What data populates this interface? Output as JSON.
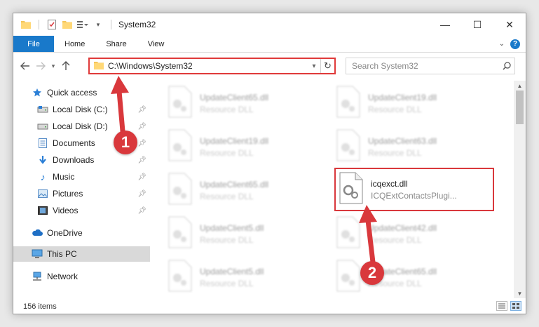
{
  "window": {
    "title": "System32",
    "controls": {
      "minimize": "—",
      "maximize": "☐",
      "close": "✕"
    }
  },
  "ribbon": {
    "tabs": [
      {
        "label": "File"
      },
      {
        "label": "Home"
      },
      {
        "label": "Share"
      },
      {
        "label": "View"
      }
    ],
    "help": "?"
  },
  "address": {
    "path": "C:\\Windows\\System32",
    "search_placeholder": "Search System32"
  },
  "sidebar": {
    "items": [
      {
        "label": "Quick access",
        "icon": "star-icon"
      },
      {
        "label": "Local Disk (C:)",
        "icon": "drive-icon",
        "pinned": true
      },
      {
        "label": "Local Disk (D:)",
        "icon": "drive-icon",
        "pinned": true
      },
      {
        "label": "Documents",
        "icon": "documents-icon",
        "pinned": true
      },
      {
        "label": "Downloads",
        "icon": "downloads-icon",
        "pinned": true
      },
      {
        "label": "Music",
        "icon": "music-icon",
        "pinned": true
      },
      {
        "label": "Pictures",
        "icon": "pictures-icon",
        "pinned": true
      },
      {
        "label": "Videos",
        "icon": "videos-icon",
        "pinned": true
      },
      {
        "label": "OneDrive",
        "icon": "cloud-icon"
      },
      {
        "label": "This PC",
        "icon": "computer-icon",
        "selected": true
      },
      {
        "label": "Network",
        "icon": "network-icon"
      }
    ]
  },
  "files": [
    {
      "name": "UpdateClient65.dll",
      "type": "Resource DLL"
    },
    {
      "name": "UpdateClient19.dll",
      "type": "Resource DLL"
    },
    {
      "name": "UpdateClient19.dll",
      "type": "Resource DLL"
    },
    {
      "name": "UpdateClient63.dll",
      "type": "Resource DLL"
    },
    {
      "name": "UpdateClient65.dll",
      "type": "Resource DLL"
    },
    {
      "name": "icqexct.dll",
      "type": "ICQExtContactsPlugi...",
      "highlighted": true
    },
    {
      "name": "UpdateClient5.dll",
      "type": "Resource DLL"
    },
    {
      "name": "UpdateClient42.dll",
      "type": "Resource DLL"
    },
    {
      "name": "UpdateClient5.dll",
      "type": "Resource DLL"
    },
    {
      "name": "UpdateClient65.dll",
      "type": "Resource DLL"
    }
  ],
  "status": {
    "item_count": "156 items"
  },
  "annotations": {
    "step1": "1",
    "step2": "2",
    "color": "#d9383c"
  },
  "colors": {
    "accent": "#1979ca",
    "highlight": "#d9383c"
  }
}
